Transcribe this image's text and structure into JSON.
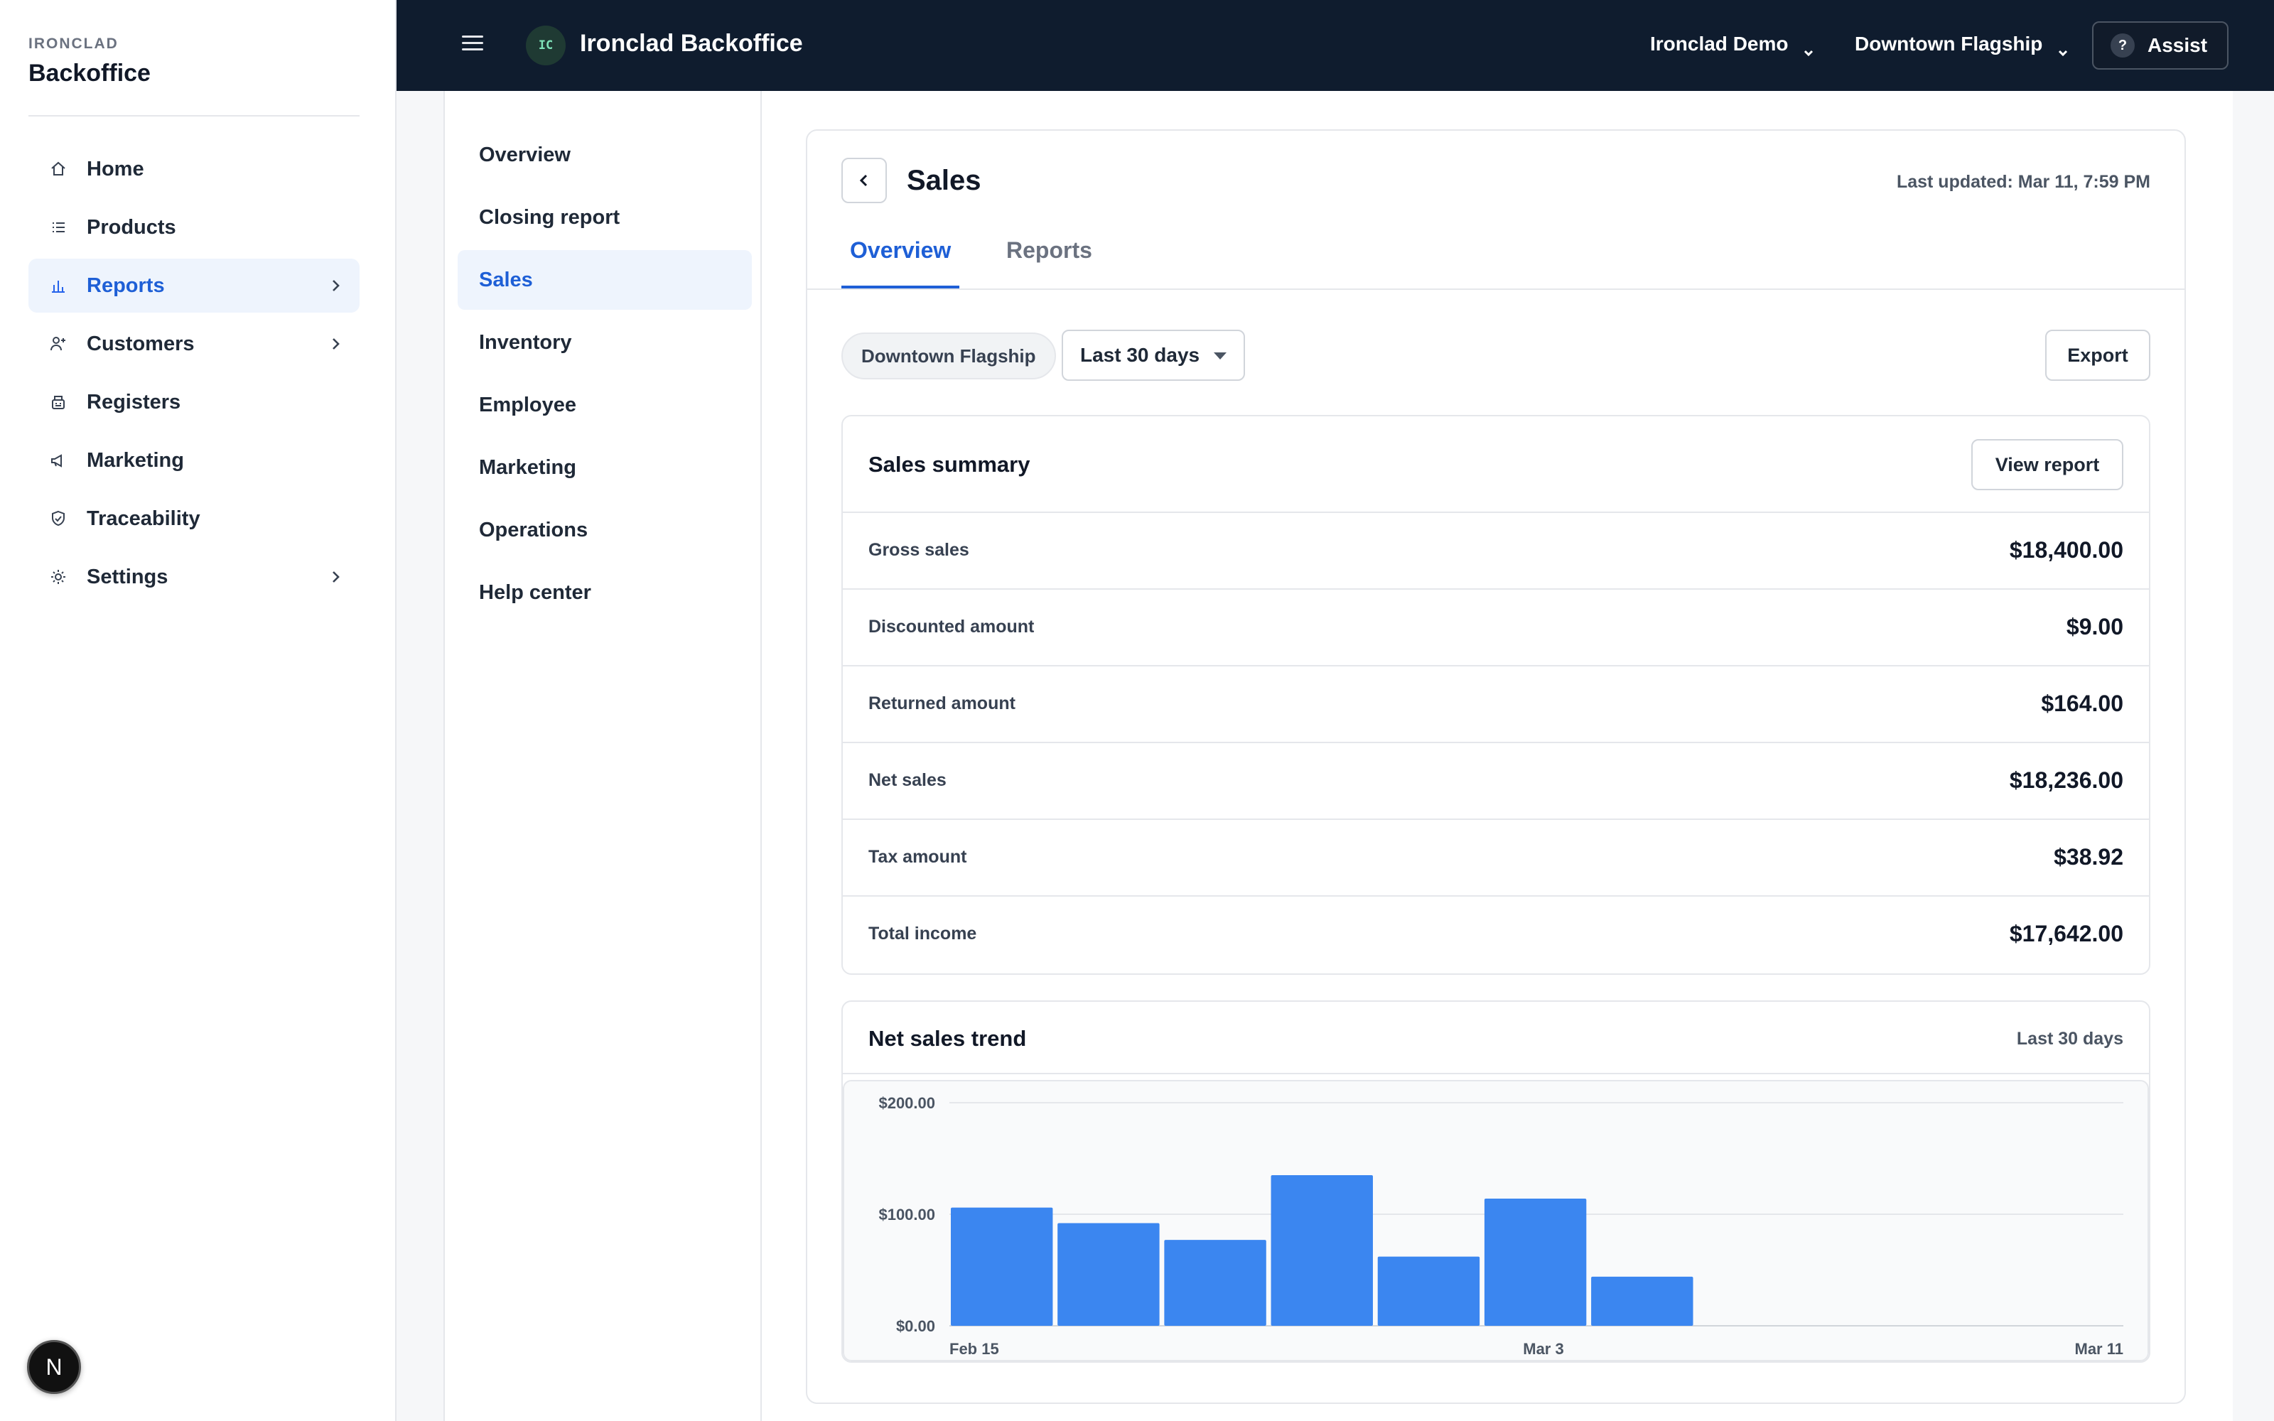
{
  "brand": {
    "small": "IRONCLAD",
    "big": "Backoffice"
  },
  "sidebar": {
    "items": [
      {
        "label": "Home",
        "icon": "home-icon",
        "chevron": false,
        "active": false
      },
      {
        "label": "Products",
        "icon": "list-icon",
        "chevron": false,
        "active": false
      },
      {
        "label": "Reports",
        "icon": "bar-chart-icon",
        "chevron": true,
        "active": true
      },
      {
        "label": "Customers",
        "icon": "user-plus-icon",
        "chevron": true,
        "active": false
      },
      {
        "label": "Registers",
        "icon": "register-icon",
        "chevron": false,
        "active": false
      },
      {
        "label": "Marketing",
        "icon": "megaphone-icon",
        "chevron": false,
        "active": false
      },
      {
        "label": "Traceability",
        "icon": "shield-icon",
        "chevron": false,
        "active": false
      },
      {
        "label": "Settings",
        "icon": "gear-icon",
        "chevron": true,
        "active": false
      }
    ],
    "badge": "N"
  },
  "topbar": {
    "logo": "IC",
    "title": "Ironclad Backoffice",
    "org": "Ironclad Demo",
    "location": "Downtown Flagship",
    "assist_icon": "?",
    "assist_label": "Assist"
  },
  "subnav": {
    "items": [
      {
        "label": "Overview",
        "active": false
      },
      {
        "label": "Closing report",
        "active": false
      },
      {
        "label": "Sales",
        "active": true
      },
      {
        "label": "Inventory",
        "active": false
      },
      {
        "label": "Employee",
        "active": false
      },
      {
        "label": "Marketing",
        "active": false
      },
      {
        "label": "Operations",
        "active": false
      },
      {
        "label": "Help center",
        "active": false
      }
    ]
  },
  "page": {
    "title": "Sales",
    "last_updated": "Last updated: Mar 11, 7:59 PM",
    "tabs": [
      {
        "label": "Overview",
        "active": true
      },
      {
        "label": "Reports",
        "active": false
      }
    ],
    "filters": {
      "location_chip": "Downtown Flagship",
      "range": "Last 30 days",
      "export_label": "Export"
    }
  },
  "summary": {
    "title": "Sales summary",
    "view_report_label": "View report",
    "rows": [
      {
        "label": "Gross sales",
        "value": "$18,400.00"
      },
      {
        "label": "Discounted amount",
        "value": "$9.00"
      },
      {
        "label": "Returned amount",
        "value": "$164.00"
      },
      {
        "label": "Net sales",
        "value": "$18,236.00"
      },
      {
        "label": "Tax amount",
        "value": "$38.92"
      },
      {
        "label": "Total income",
        "value": "$17,642.00"
      }
    ]
  },
  "trend": {
    "title": "Net sales trend",
    "range": "Last 30 days"
  },
  "chart_data": {
    "type": "bar",
    "title": "Net sales trend",
    "y_ticks": [
      "$200.00",
      "$100.00",
      "$0.00"
    ],
    "ylim": [
      0,
      200
    ],
    "x_tick_labels": [
      "Feb 15",
      "Mar 3",
      "Mar 11"
    ],
    "values": [
      106,
      92,
      77,
      135,
      62,
      114,
      44,
      0,
      0,
      0,
      0
    ],
    "bar_color": "#3b86f0",
    "grid": true
  }
}
